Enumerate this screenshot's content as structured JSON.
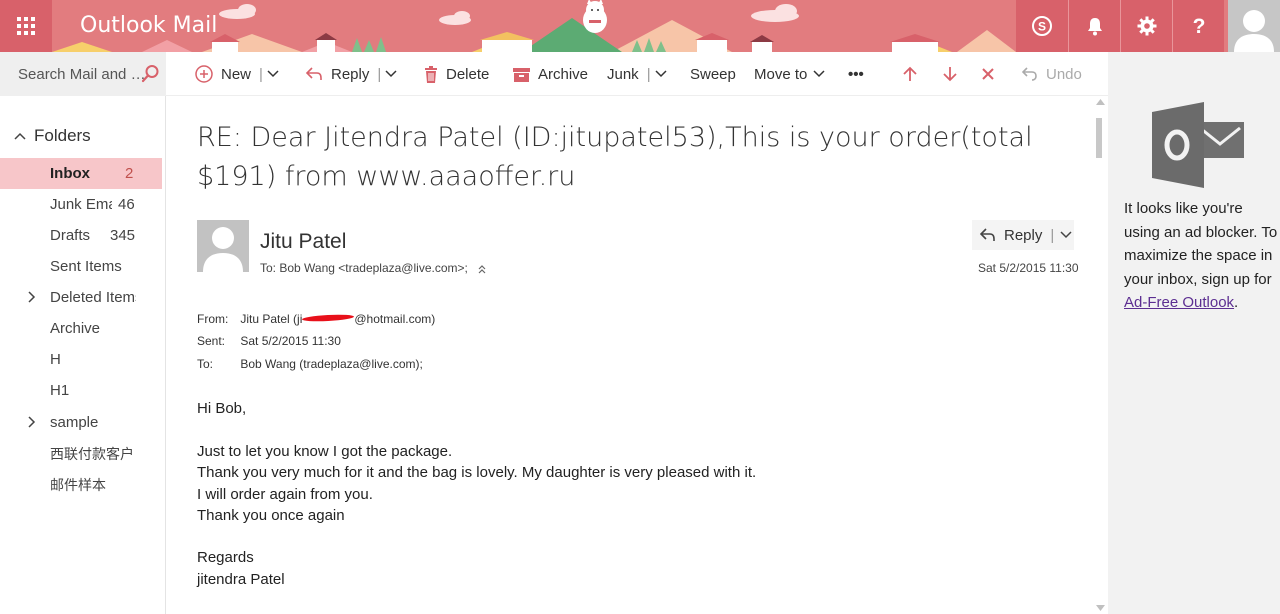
{
  "header": {
    "app_title": "Outlook Mail",
    "icons": [
      "app-launcher-icon",
      "skype-icon",
      "bell-icon",
      "gear-icon",
      "help-icon",
      "user-avatar-icon"
    ],
    "colors": {
      "brand": "#e27c7f",
      "brand_dark": "#d8616a"
    }
  },
  "search": {
    "placeholder": "Search Mail and People"
  },
  "toolbar": {
    "new": "New",
    "reply": "Reply",
    "delete": "Delete",
    "archive": "Archive",
    "junk": "Junk",
    "sweep": "Sweep",
    "move_to": "Move to",
    "more": "•••",
    "undo": "Undo"
  },
  "sidebar": {
    "folders_label": "Folders",
    "items": [
      {
        "name": "Inbox",
        "count": "2"
      },
      {
        "name": "Junk Email",
        "count": "46"
      },
      {
        "name": "Drafts",
        "count": "345"
      },
      {
        "name": "Sent Items",
        "count": ""
      },
      {
        "name": "Deleted Items",
        "count": ""
      },
      {
        "name": "Archive",
        "count": ""
      },
      {
        "name": "H",
        "count": ""
      },
      {
        "name": "H1",
        "count": ""
      },
      {
        "name": "sample",
        "count": ""
      },
      {
        "name": "西联付款客户",
        "count": ""
      },
      {
        "name": "邮件样本",
        "count": ""
      }
    ]
  },
  "message": {
    "subject": "RE: Dear Jitendra Patel (ID:jitupatel53),This is your order(total $191) from www.aaaoffer.ru",
    "sender_name": "Jitu Patel",
    "to_line": "To:  Bob Wang <tradeplaza@live.com>;",
    "reply_label": "Reply",
    "date": "Sat 5/2/2015 11:30",
    "meta": {
      "from_key": "From:",
      "from_prefix": "Jitu Patel (ji",
      "from_suffix": "@hotmail.com)",
      "sent_key": "Sent:",
      "sent_value": "Sat 5/2/2015 11:30",
      "to_key": "To:",
      "to_value": "Bob Wang (tradeplaza@live.com);"
    },
    "body": [
      "Hi Bob,",
      "Just to let you know I got the package.",
      "Thank you very much for it and the bag is lovely. My daughter is very pleased with it.",
      "I will order again from you.",
      "Thank you once again",
      "Regards",
      "jitendra Patel"
    ]
  },
  "ad": {
    "text": "It looks like you're using an ad blocker. To maximize the space in your inbox, sign up for ",
    "link": "Ad-Free Outlook",
    "suffix": "."
  }
}
